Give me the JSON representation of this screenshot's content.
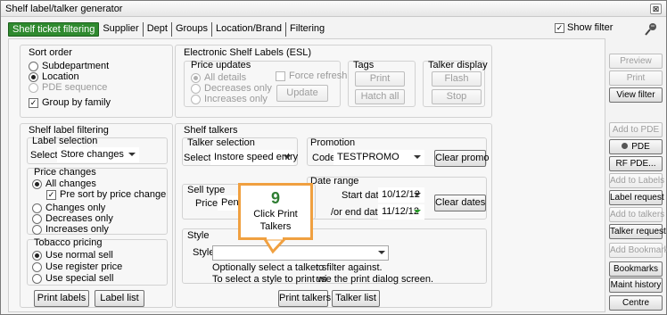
{
  "window": {
    "title": "Shelf label/talker generator",
    "close": "⊠"
  },
  "tabs": [
    "Shelf ticket filtering",
    "Supplier",
    "Dept",
    "Groups",
    "Location/Brand",
    "Filtering"
  ],
  "show_filter": {
    "label": "Show filter",
    "checked": true
  },
  "sort_order": {
    "title": "Sort order",
    "options": [
      "Subdepartment",
      "Location",
      "PDE sequence"
    ],
    "selected": "Location",
    "group_by_family": "Group by family"
  },
  "esl": {
    "title": "Electronic Shelf Labels (ESL)",
    "price_updates": {
      "title": "Price updates",
      "options": [
        "All details",
        "Decreases only",
        "Increases only"
      ],
      "force_refresh": "Force refresh",
      "update": "Update"
    },
    "tags": {
      "title": "Tags",
      "print": "Print",
      "hatch_all": "Hatch all"
    },
    "talker_display": {
      "title": "Talker display",
      "flash": "Flash",
      "stop": "Stop"
    }
  },
  "shelf_label_filtering": {
    "title": "Shelf label filtering",
    "label_selection": {
      "title": "Label selection",
      "select_label": "Select",
      "value": "Store changes"
    },
    "price_changes": {
      "title": "Price changes",
      "all_changes": "All changes",
      "pre_sort": "Pre sort by price change",
      "changes_only": "Changes only",
      "decreases_only": "Decreases only",
      "increases_only": "Increases only"
    },
    "tobacco_pricing": {
      "title": "Tobacco pricing",
      "options": [
        "Use normal sell",
        "Use register price",
        "Use special sell"
      ]
    },
    "print_labels": "Print labels",
    "label_list": "Label list"
  },
  "shelf_talkers": {
    "title": "Shelf talkers",
    "talker_selection": {
      "title": "Talker  selection",
      "select_label": "Select",
      "value": "Instore speed entry"
    },
    "promotion": {
      "title": "Promotion",
      "code_label": "Code",
      "value": "TESTPROMO",
      "clear": "Clear promo"
    },
    "sell_type": {
      "title": "Sell type",
      "price_label": "Price",
      "value": "Pendi"
    },
    "date_range": {
      "title": "Date range",
      "start_label": "Start date",
      "start": "10/12/12",
      "end_label": "/or end date",
      "end": "11/12/12",
      "clear": "Clear dates"
    },
    "style": {
      "title": "Style",
      "style_label": "Style",
      "value": "",
      "hint1": "Optionally select a talker s",
      "hint1b": "to filter against.",
      "hint2": "To select a style to print wi",
      "hint2b": "use the print dialog screen."
    },
    "print_talkers": "Print talkers",
    "talker_list": "Talker list"
  },
  "callout": {
    "number": "9",
    "line1": "Click Print",
    "line2": "Talkers"
  },
  "sidebar": [
    "Preview",
    "Print",
    "View filter",
    "Add to PDE",
    "PDE",
    "RF PDE...",
    "Add to Labels",
    "Label request",
    "Add to talkers",
    "Talker request",
    "Add Bookmark",
    "Bookmarks",
    "Maint history",
    "Centre"
  ],
  "colors": {
    "accent": "#2f8a2f",
    "callout_border": "#f0a040",
    "callout_number": "#2e7d32"
  }
}
